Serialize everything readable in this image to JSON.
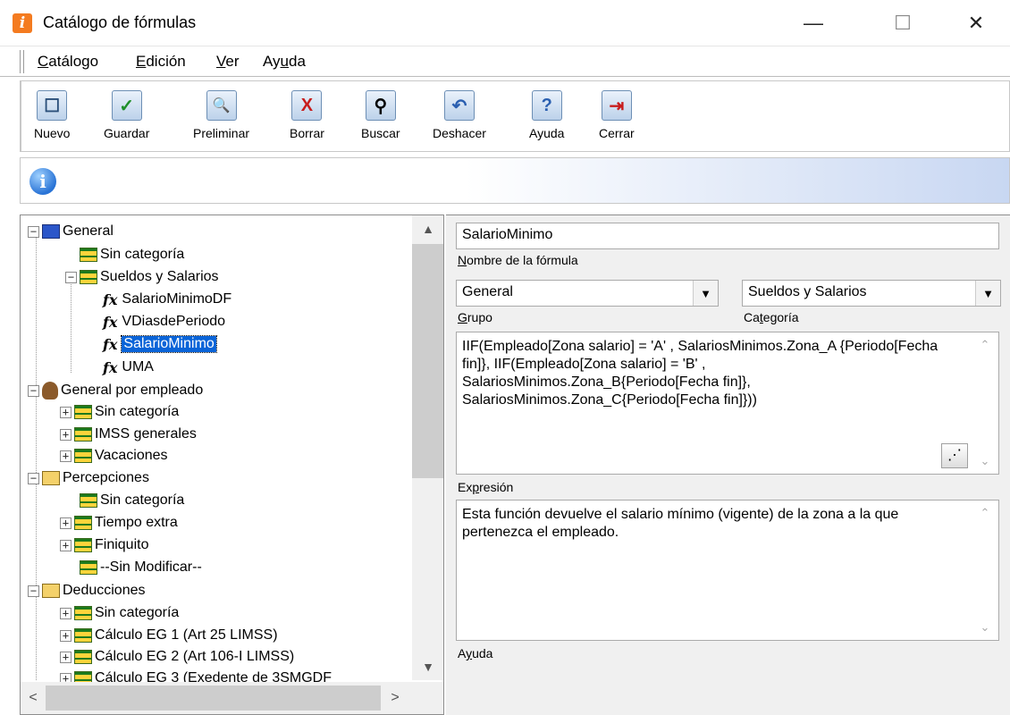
{
  "window": {
    "title": "Catálogo de fórmulas",
    "app_icon_glyph": "i",
    "min_glyph": "—",
    "max_glyph": "☐",
    "close_glyph": "✕"
  },
  "menu": [
    {
      "accel": "C",
      "rest": "atálogo"
    },
    {
      "accel": "E",
      "rest": "dición"
    },
    {
      "accel": "V",
      "rest": "er"
    },
    {
      "pre": "Ay",
      "accel": "u",
      "rest": "da"
    }
  ],
  "toolbar": {
    "nuevo": "Nuevo",
    "guardar": "Guardar",
    "preliminar": "Preliminar",
    "borrar": "Borrar",
    "buscar": "Buscar",
    "deshacer": "Deshacer",
    "ayuda": "Ayuda",
    "cerrar": "Cerrar",
    "icons": {
      "nuevo": "☐",
      "guardar": "✓",
      "preliminar": "🔍",
      "borrar": "X",
      "buscar": "⚲",
      "deshacer": "↶",
      "ayuda": "?",
      "cerrar": "⇥"
    }
  },
  "info_glyph": "i",
  "tree": {
    "nodes": [
      {
        "label": "General"
      },
      {
        "label": "Sin categoría"
      },
      {
        "label": "Sueldos y Salarios"
      },
      {
        "label": "SalarioMinimoDF"
      },
      {
        "label": "VDiasdePeriodo"
      },
      {
        "label": "SalarioMinimo"
      },
      {
        "label": "UMA"
      },
      {
        "label": "General por empleado"
      },
      {
        "label": "Sin categoría"
      },
      {
        "label": "IMSS generales"
      },
      {
        "label": "Vacaciones"
      },
      {
        "label": "Percepciones"
      },
      {
        "label": "Sin categoría"
      },
      {
        "label": "Tiempo extra"
      },
      {
        "label": "Finiquito"
      },
      {
        "label": "--Sin Modificar--"
      },
      {
        "label": "Deducciones"
      },
      {
        "label": "Sin categoría"
      },
      {
        "label": "Cálculo EG 1 (Art 25 LIMSS)"
      },
      {
        "label": "Cálculo EG 2 (Art 106-I LIMSS)"
      },
      {
        "label": "Cálculo EG 3 (Exedente de 3SMGDF"
      }
    ],
    "fx_glyph": "fx",
    "expand_plus": "+",
    "expand_minus": "−",
    "scroll_up": "▲",
    "scroll_down": "▼",
    "scroll_left": "<",
    "scroll_right": ">"
  },
  "form": {
    "nombre_value": "SalarioMinimo",
    "nombre_caption": {
      "accel": "N",
      "rest": "ombre de la fórmula"
    },
    "grupo_value": "General",
    "grupo_caption": {
      "accel": "G",
      "rest": "rupo"
    },
    "categoria_value": "Sueldos y Salarios",
    "categoria_caption": {
      "pre": "Ca",
      "accel": "t",
      "rest": "egoría"
    },
    "expresion_value": "IIF(Empleado[Zona salario] = 'A' , SalariosMinimos.Zona_A {Periodo[Fecha fin]}, IIF(Empleado[Zona salario] = 'B' , SalariosMinimos.Zona_B{Periodo[Fecha fin]}, SalariosMinimos.Zona_C{Periodo[Fecha fin]}))",
    "expresion_caption": {
      "pre": "Ex",
      "accel": "p",
      "rest": "resión"
    },
    "ayuda_value": "Esta función devuelve el salario mínimo (vigente) de la zona a la que pertenezca el empleado.",
    "ayuda_caption": {
      "pre": "A",
      "accel": "y",
      "rest": "uda"
    },
    "combo_arrow": "▼",
    "ta_up": "⌃",
    "ta_down": "⌄",
    "wizard_glyph": "⋰"
  }
}
